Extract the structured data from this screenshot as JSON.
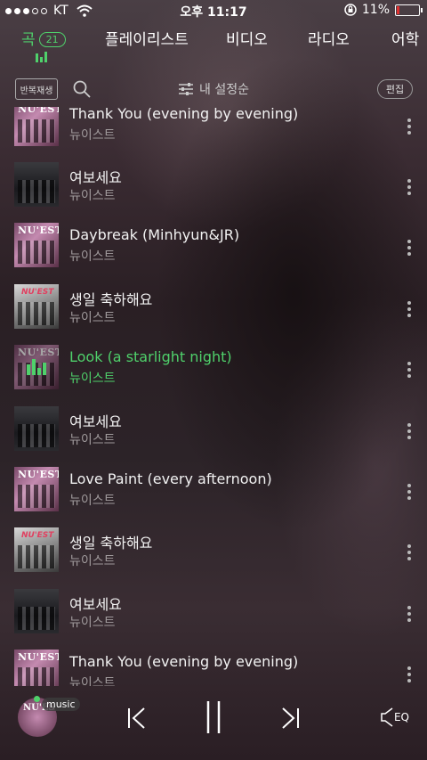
{
  "status": {
    "carrier": "KT",
    "time": "오후 11:17",
    "battery": "11%"
  },
  "tabs": [
    {
      "label": "곡",
      "badge": "21",
      "active": true
    },
    {
      "label": "플레이리스트"
    },
    {
      "label": "비디오"
    },
    {
      "label": "라디오"
    },
    {
      "label": "어학"
    }
  ],
  "toolbar": {
    "repeat_label": "반복재생",
    "sort_label": "내 설정순",
    "edit_label": "편집"
  },
  "songs": [
    {
      "title": "Thank You (evening by evening)",
      "artist": "뉴이스트",
      "art": "a"
    },
    {
      "title": "여보세요",
      "artist": "뉴이스트",
      "art": "b"
    },
    {
      "title": "Daybreak (Minhyun&JR)",
      "artist": "뉴이스트",
      "art": "a"
    },
    {
      "title": "생일 축하해요",
      "artist": "뉴이스트",
      "art": "c"
    },
    {
      "title": "Look (a starlight night)",
      "artist": "뉴이스트",
      "art": "a",
      "playing": true
    },
    {
      "title": "여보세요",
      "artist": "뉴이스트",
      "art": "b"
    },
    {
      "title": "Love Paint (every afternoon)",
      "artist": "뉴이스트",
      "art": "a"
    },
    {
      "title": "생일 축하해요",
      "artist": "뉴이스트",
      "art": "c"
    },
    {
      "title": "여보세요",
      "artist": "뉴이스트",
      "art": "b"
    },
    {
      "title": "Thank You (evening by evening)",
      "artist": "뉴이스트",
      "art": "a"
    }
  ],
  "player": {
    "source_tag": "music",
    "eq_label": "EQ"
  },
  "album_logo": "NU'EST",
  "accent_color": "#4fd16b"
}
